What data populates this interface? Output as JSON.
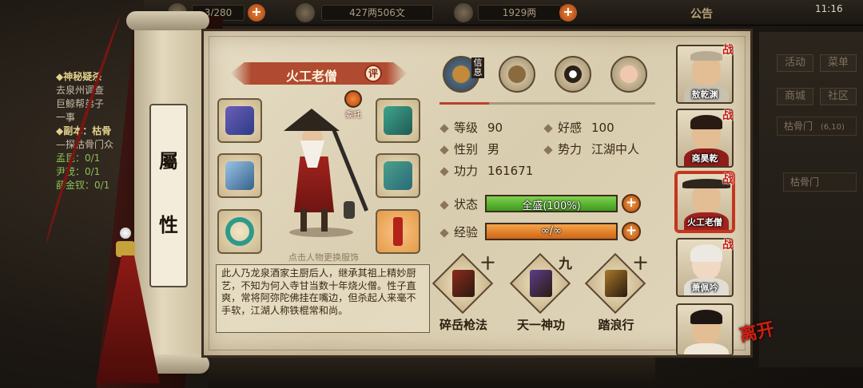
{
  "topbar": {
    "bag": "3/280",
    "silver": "427两506文",
    "gold": "1929两",
    "announce": "公告",
    "clock": "11:16"
  },
  "quest": {
    "title": "◆神秘疑杀",
    "lines": [
      "去泉州调查",
      "巨鲸帮弟子",
      "一事"
    ],
    "sub_title": "◆副本：枯骨",
    "sub_desc": "—探枯骨门众",
    "items": [
      "孟昆：0/1",
      "尹茂：0/1",
      "薛金钗：0/1"
    ]
  },
  "right_menu": {
    "btn1": "活动",
    "btn2": "菜单",
    "btn3": "商城",
    "btn4": "社区",
    "row1": "枯骨门",
    "row1_count": "(6,10)",
    "row2": "枯骨门"
  },
  "scroll": {
    "char1": "屬",
    "char2": "性"
  },
  "character": {
    "name": "火工老僧",
    "rate_badge": "评",
    "delegate_label": "委托",
    "hint": "点击人物更换服饰",
    "description": "此人乃龙泉酒家主厨后人，继承其祖上精妙厨艺，不知为何入寺甘当数十年烧火僧。性子直爽，常将阿弥陀佛挂在嘴边，但杀起人来毫不手软，江湖人称铁棍常和尚。"
  },
  "tabs": {
    "active_label": "信息"
  },
  "stats": {
    "level_label": "等级",
    "level": "90",
    "favor_label": "好感",
    "favor": "100",
    "gender_label": "性别",
    "gender": "男",
    "faction_label": "势力",
    "faction": "江湖中人",
    "power_label": "功力",
    "power": "161671"
  },
  "bars": {
    "state_label": "状态",
    "state_text": "全盛(100%)",
    "state_fraction": 1.0,
    "exp_label": "经验",
    "exp_text": "∞/∞",
    "exp_fraction": 1.0,
    "plus": "+"
  },
  "skills": [
    {
      "name": "碎岳枪法",
      "level": "十",
      "color": "#8e2a1e"
    },
    {
      "name": "天一神功",
      "level": "九",
      "color": "#5b3e8a"
    },
    {
      "name": "踏浪行",
      "level": "十",
      "color": "#a8792a"
    }
  ],
  "roster": [
    {
      "name": "敖乾渊",
      "battle": "战"
    },
    {
      "name": "商昊乾",
      "battle": "战"
    },
    {
      "name": "火工老僧",
      "battle": "战"
    },
    {
      "name": "萧佩吟",
      "battle": "战"
    },
    {
      "name": ""
    }
  ],
  "leave": "离开",
  "plus_sign": "+",
  "colors": {
    "accent": "#b04a30",
    "state_bar": "#4caf2a",
    "exp_bar": "#e07a1e"
  }
}
